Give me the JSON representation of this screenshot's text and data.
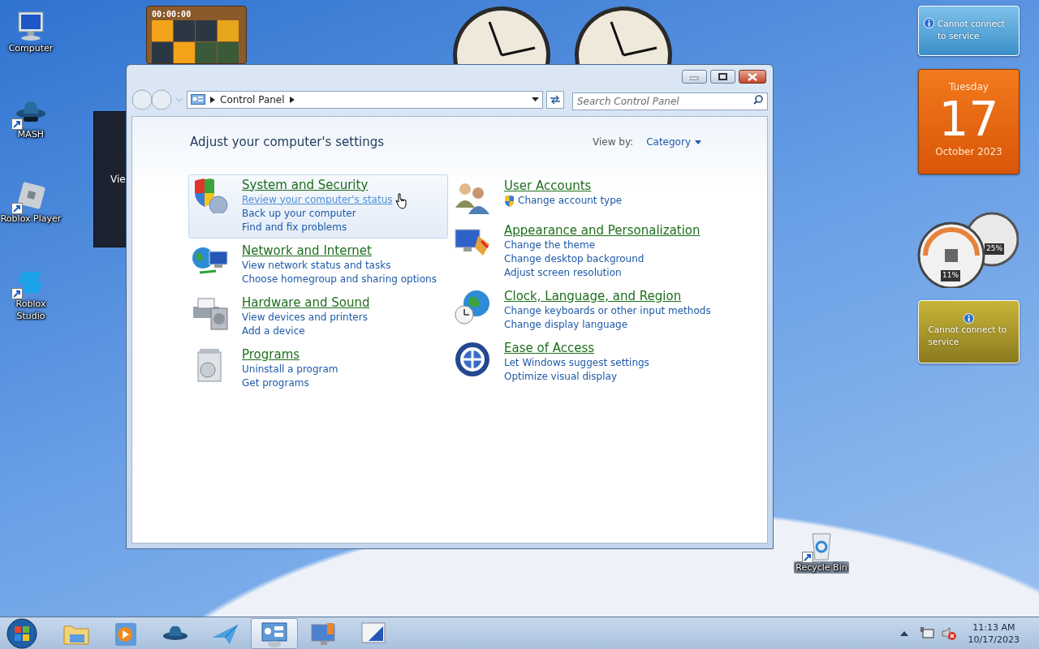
{
  "desktop_icons": [
    {
      "label": "Computer",
      "kind": "computer"
    },
    {
      "label": "MASH",
      "kind": "hat"
    },
    {
      "label": "Roblox Player",
      "kind": "player"
    },
    {
      "label": "Roblox Studio",
      "kind": "studio"
    },
    {
      "label": "Recycle Bin",
      "kind": "bin"
    }
  ],
  "gadgets": {
    "puzzle": {
      "timer": "00:00:00"
    },
    "weather": [
      {
        "message": "Cannot connect to service",
        "kind": "blue"
      },
      {
        "message": "Cannot connect to service",
        "kind": "gold"
      }
    ],
    "calendar": {
      "weekday": "Tuesday",
      "day": "17",
      "month": "October 2023"
    },
    "meter": {
      "cpu": "11%",
      "memory": "25%"
    }
  },
  "background_window": {
    "text": "Vie"
  },
  "window": {
    "address": "Control Panel",
    "search": {
      "placeholder": "Search Control Panel"
    },
    "heading": "Adjust your computer's settings",
    "view_by": {
      "label": "View by:",
      "value": "Category"
    },
    "columns": [
      {
        "categories": [
          {
            "title": "System and Security",
            "highlighted": true,
            "links": [
              {
                "text": "Review your computer's status",
                "hovered": true,
                "shield": false
              },
              {
                "text": "Back up your computer",
                "hovered": false,
                "shield": false
              },
              {
                "text": "Find and fix problems",
                "hovered": false,
                "shield": false
              }
            ]
          },
          {
            "title": "Network and Internet",
            "highlighted": false,
            "links": [
              {
                "text": "View network status and tasks",
                "hovered": false,
                "shield": false
              },
              {
                "text": "Choose homegroup and sharing options",
                "hovered": false,
                "shield": false
              }
            ]
          },
          {
            "title": "Hardware and Sound",
            "highlighted": false,
            "links": [
              {
                "text": "View devices and printers",
                "hovered": false,
                "shield": false
              },
              {
                "text": "Add a device",
                "hovered": false,
                "shield": false
              }
            ]
          },
          {
            "title": "Programs",
            "highlighted": false,
            "links": [
              {
                "text": "Uninstall a program",
                "hovered": false,
                "shield": false
              },
              {
                "text": "Get programs",
                "hovered": false,
                "shield": false
              }
            ]
          }
        ]
      },
      {
        "categories": [
          {
            "title": "User Accounts",
            "highlighted": false,
            "links": [
              {
                "text": "Change account type",
                "hovered": false,
                "shield": true
              }
            ]
          },
          {
            "title": "Appearance and Personalization",
            "highlighted": false,
            "links": [
              {
                "text": "Change the theme",
                "hovered": false,
                "shield": false
              },
              {
                "text": "Change desktop background",
                "hovered": false,
                "shield": false
              },
              {
                "text": "Adjust screen resolution",
                "hovered": false,
                "shield": false
              }
            ]
          },
          {
            "title": "Clock, Language, and Region",
            "highlighted": false,
            "links": [
              {
                "text": "Change keyboards or other input methods",
                "hovered": false,
                "shield": false
              },
              {
                "text": "Change display language",
                "hovered": false,
                "shield": false
              }
            ]
          },
          {
            "title": "Ease of Access",
            "highlighted": false,
            "links": [
              {
                "text": "Let Windows suggest settings",
                "hovered": false,
                "shield": false
              },
              {
                "text": "Optimize visual display",
                "hovered": false,
                "shield": false
              }
            ]
          }
        ]
      }
    ]
  },
  "taskbar": {
    "items": [
      {
        "kind": "folder",
        "active": false
      },
      {
        "kind": "media",
        "active": false
      },
      {
        "kind": "hat",
        "active": false
      },
      {
        "kind": "plane",
        "active": false
      },
      {
        "kind": "panel",
        "active": true
      },
      {
        "kind": "monitor",
        "active": false
      },
      {
        "kind": "display",
        "active": false
      }
    ],
    "time": "11:13 AM",
    "date": "10/17/2023"
  }
}
